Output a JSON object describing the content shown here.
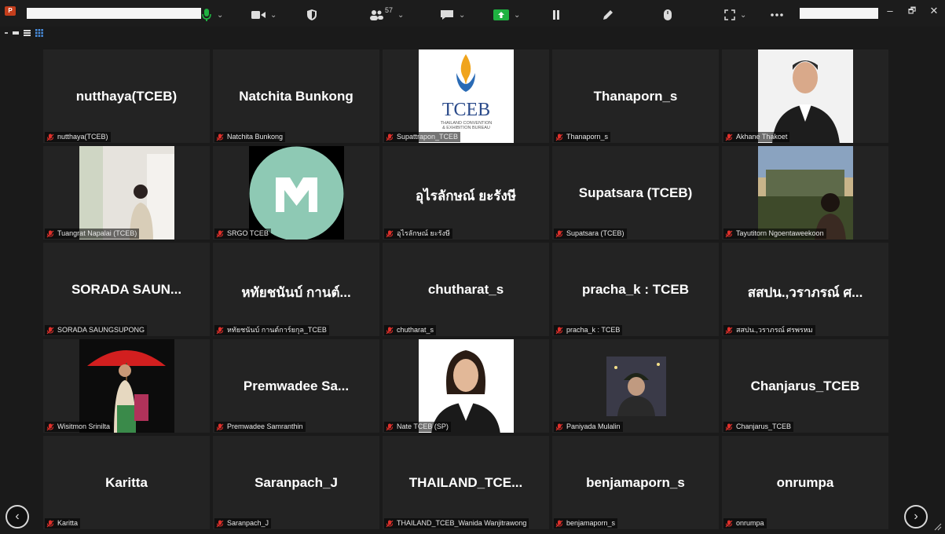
{
  "app": {
    "icon_letter": "P",
    "toolbar": {
      "participants_count": "57"
    },
    "window_controls": {
      "minimize": "–",
      "restore": "🗗",
      "close": "✕"
    }
  },
  "colors": {
    "background": "#1a1a1a",
    "tile": "#232323",
    "mic_muted": "#e0302b",
    "active_green": "#1fb141",
    "teal_logo": "#8ec9b4"
  },
  "navigation": {
    "prev": "‹",
    "next": "›"
  },
  "tiles": [
    {
      "big": "nutthaya(TCEB)",
      "label": "nutthaya(TCEB)"
    },
    {
      "big": "Natchita Bunkong",
      "label": "Natchita Bunkong"
    },
    {
      "big": "",
      "label": "Supattrapon_TCEB",
      "logo": {
        "main": "TCEB",
        "line1": "THAILAND CONVENTION",
        "line2": "& EXHIBITION BUREAU"
      }
    },
    {
      "big": "Thanaporn_s",
      "label": "Thanaporn_s"
    },
    {
      "big": "",
      "label": "Akhane Thakoet"
    },
    {
      "big": "",
      "label": "Tuangrat Napalai (TCEB)"
    },
    {
      "big": "",
      "label": "SRGO TCEB"
    },
    {
      "big": "อุไรลักษณ์ ยะรังษี",
      "label": "อุไรลักษณ์ ยะรังษี"
    },
    {
      "big": "Supatsara (TCEB)",
      "label": "Supatsara (TCEB)"
    },
    {
      "big": "",
      "label": "Tayutitorn Ngoentaweekoon"
    },
    {
      "big": "SORADA SAUN...",
      "label": "SORADA SAUNGSUPONG"
    },
    {
      "big": "หทัยชนันบ์ กานต์...",
      "label": "หทัยชนันบ์ กานต์การ์ยกุล_TCEB"
    },
    {
      "big": "chutharat_s",
      "label": "chutharat_s"
    },
    {
      "big": "pracha_k : TCEB",
      "label": "pracha_k : TCEB"
    },
    {
      "big": "สสปน.,วราภรณ์ ศ...",
      "label": "สสปน.,วราภรณ์ ศรพรหม"
    },
    {
      "big": "",
      "label": "Wisitmon Srinilta"
    },
    {
      "big": "Premwadee Sa...",
      "label": "Premwadee Samranthin"
    },
    {
      "big": "",
      "label": "Nate TCEB (SP)"
    },
    {
      "big": "",
      "label": "Paniyada Mulalin"
    },
    {
      "big": "Chanjarus_TCEB",
      "label": "Chanjarus_TCEB"
    },
    {
      "big": "Karitta",
      "label": "Karitta"
    },
    {
      "big": "Saranpach_J",
      "label": "Saranpach_J"
    },
    {
      "big": "THAILAND_TCE...",
      "label": "THAILAND_TCEB_Wanida Wanjitrawong"
    },
    {
      "big": "benjamaporn_s",
      "label": "benjamaporn_s"
    },
    {
      "big": "onrumpa",
      "label": "onrumpa"
    }
  ]
}
